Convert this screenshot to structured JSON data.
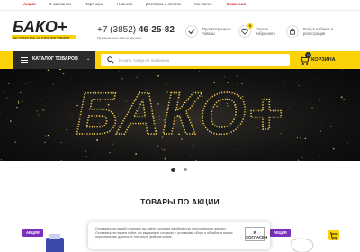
{
  "topnav": {
    "items": [
      {
        "label": "Акции",
        "active": true
      },
      {
        "label": "О компании",
        "active": false
      },
      {
        "label": "Партнеры",
        "active": false
      },
      {
        "label": "Новости",
        "active": false
      },
      {
        "label": "Доставка и оплата",
        "active": false
      },
      {
        "label": "Контакты",
        "active": false
      },
      {
        "label": "Вакансии",
        "active": true
      }
    ]
  },
  "header": {
    "logo_text": "БАКО+",
    "logo_tagline": "НЕ ТОЛЬКО ВСЕ, НО И ВСЁ ДЛЯ ТОВАРОВ",
    "phone_prefix": "+7 (3852)",
    "phone_number": "46-25-82",
    "phone_note": "Принимаем ваши звонки",
    "viewed_label": "Просмотренные товары",
    "favorites_label": "Список избранного",
    "favorites_count": "0",
    "login_label": "Вход в кабинет и регистрация"
  },
  "catbar": {
    "catalog_label": "КАТАЛОГ ТОВАРОВ",
    "search_placeholder": "Искать товар по названию",
    "cart_label": "КОРЗИНА",
    "cart_count": "0"
  },
  "banner": {
    "text": "БАКО+"
  },
  "slider": {
    "slide_count": 2,
    "active_index": 0
  },
  "promo": {
    "title": "ТОВАРЫ ПО АКЦИИ",
    "badge_label": "АКЦИЯ"
  },
  "cookie": {
    "text": "Оставаясь на нашей странице вы даёте согласие на обработку персональных данных. Оставаясь на нашем сайте, вы выражаете согласие с условиями сбора и обработки ваших персональных данных, в том числе файлов cookie.",
    "button_label": "Я СОГЛАСЕН"
  },
  "colors": {
    "accent_yellow": "#fbd107",
    "accent_red": "#e31e24",
    "catalog_dark": "#2b2b2b",
    "badge_purple": "#7b2fbf"
  }
}
